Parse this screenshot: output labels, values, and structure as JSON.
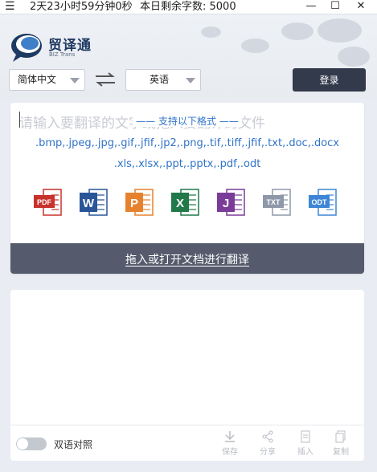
{
  "titlebar": {
    "timer": "2天23小时59分钟0秒",
    "quota": "本日剩余字数: 5000"
  },
  "brand": {
    "name": "贸译通",
    "sub": "BIZ Trans"
  },
  "lang": {
    "source": "简体中文",
    "target": "英语"
  },
  "login": {
    "label": "登录"
  },
  "upload": {
    "placeholder": "请输入要翻译的文字或拖入要翻译的文件",
    "formats_title": "—— 支持以下格式 ——",
    "formats_line1": ".bmp,.jpeg,.jpg,.gif,.jfif,.jp2,.png,.tif,.tiff,.jfif,.txt,.doc,.docx",
    "formats_line2": ".xls,.xlsx,.ppt,.pptx,.pdf,.odt",
    "file_icons": [
      {
        "name": "pdf-icon",
        "label": "PDF",
        "color": "#c8322c"
      },
      {
        "name": "word-icon",
        "label": "W",
        "color": "#2a5598"
      },
      {
        "name": "powerpoint-icon",
        "label": "P",
        "color": "#e6822d"
      },
      {
        "name": "excel-icon",
        "label": "X",
        "color": "#21794a"
      },
      {
        "name": "onenote-icon",
        "label": "J",
        "color": "#7b3c99"
      },
      {
        "name": "txt-icon",
        "label": "TXT",
        "color": "#8e98a8"
      },
      {
        "name": "odt-icon",
        "label": "ODT",
        "color": "#3d86d6"
      }
    ],
    "action_label": "拖入或打开文档进行翻译"
  },
  "output": {
    "bilingual_label": "双语对照",
    "actions": [
      {
        "name": "save",
        "label": "保存"
      },
      {
        "name": "share",
        "label": "分享"
      },
      {
        "name": "insert",
        "label": "插入"
      },
      {
        "name": "copy",
        "label": "复制"
      }
    ]
  },
  "colors": {
    "accent": "#2f73c9",
    "login_bg": "#333a4c",
    "upload_bar": "#555b6c"
  }
}
